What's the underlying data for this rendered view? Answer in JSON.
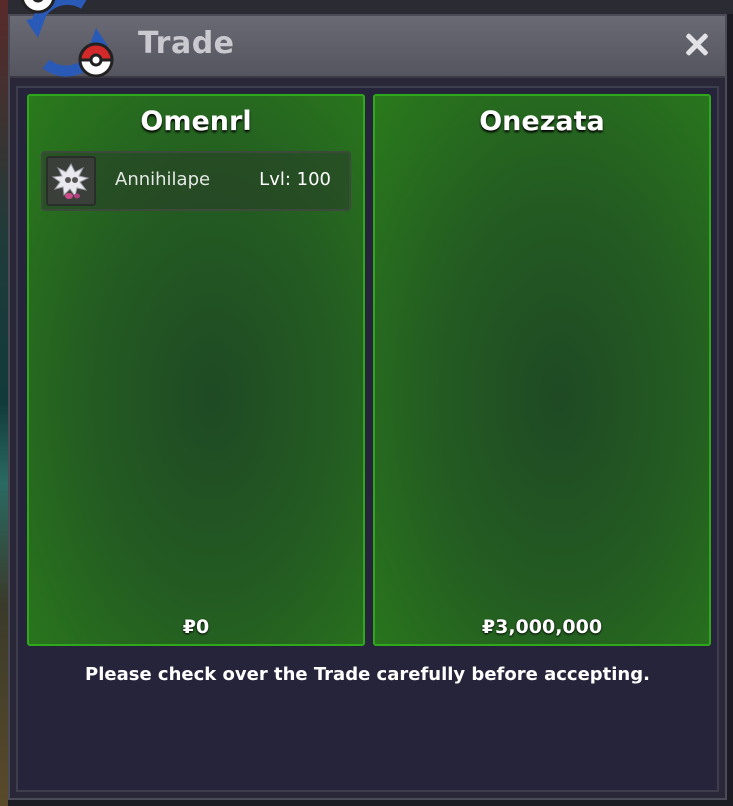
{
  "window": {
    "title": "Trade",
    "close_icon": "close-icon"
  },
  "left_panel": {
    "player": "Omenrl",
    "items": [
      {
        "name": "Annihilape",
        "level": "Lvl: 100",
        "icon": "annihilape-sprite-icon"
      }
    ],
    "money": "₽0"
  },
  "right_panel": {
    "player": "Onezata",
    "items": [],
    "money": "₽3,000,000"
  },
  "notice": "Please check over the Trade carefully before accepting.",
  "colors": {
    "panel_border": "#2fa81c",
    "panel_fill": "#235a22",
    "window_bg": "#26243a",
    "titlebar": "#5f5f69"
  }
}
